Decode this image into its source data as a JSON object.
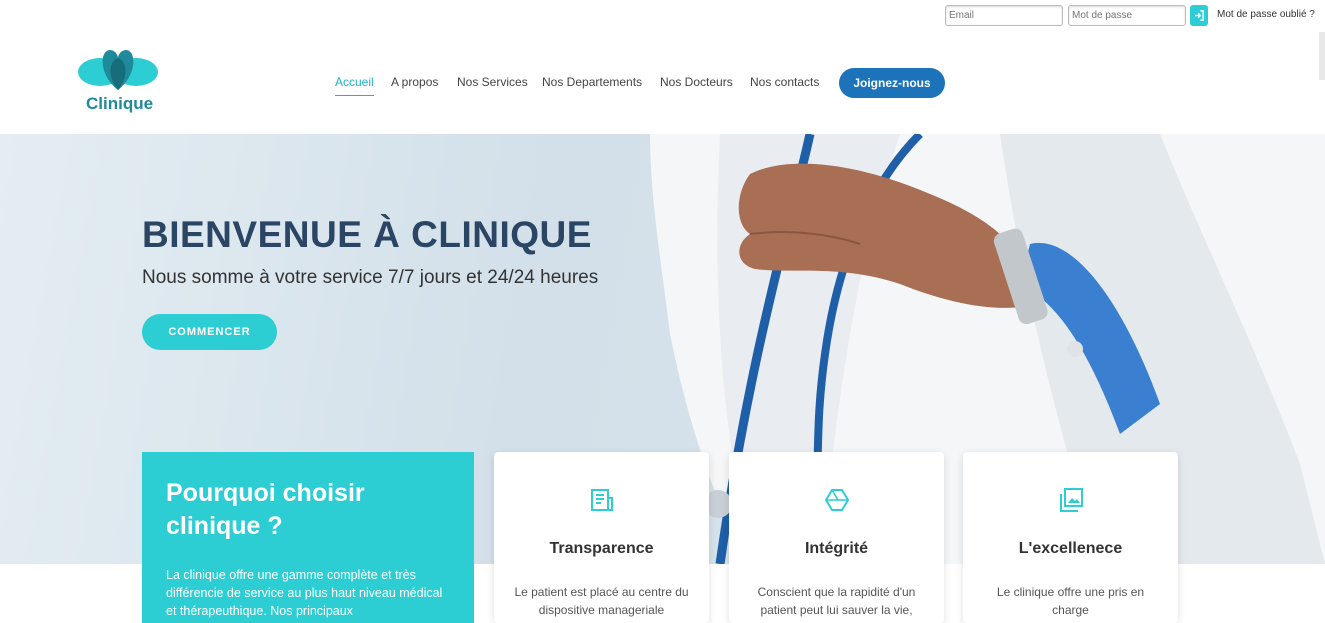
{
  "login": {
    "email_placeholder": "Email",
    "password_placeholder": "Mot de passe",
    "forgot_label": "Mot de passe oublié ?"
  },
  "brand": {
    "name": "Clinique",
    "accent": "#2dcdd4",
    "primary": "#1c73b9"
  },
  "nav": {
    "items": [
      {
        "label": "Accueil",
        "active": true
      },
      {
        "label": "A propos"
      },
      {
        "label": "Nos Services"
      },
      {
        "label": "Nos Departements"
      },
      {
        "label": "Nos Docteurs"
      },
      {
        "label": "Nos contacts"
      }
    ],
    "cta_label": "Joignez-nous"
  },
  "hero": {
    "title": "BIENVENUE À CLINIQUE",
    "subtitle": "Nous somme à votre service 7/7 jours et 24/24 heures",
    "button_label": "COMMENCER"
  },
  "why": {
    "title": "Pourquoi choisir clinique ?",
    "text": "La clinique offre une gamme complète et très différencie de service au plus haut niveau médical et thérapeuthique. Nos principaux"
  },
  "cards": [
    {
      "title": "Transparence",
      "text": "Le patient est placé au centre du dispositive manageriale",
      "icon": "document-icon"
    },
    {
      "title": "Intégrité",
      "text": "Conscient que la rapidité d'un patient peut lui sauver la vie,",
      "icon": "hexagon-icon"
    },
    {
      "title": "L'excellenece",
      "text": "Le clinique offre une pris en charge",
      "icon": "gallery-icon"
    }
  ]
}
